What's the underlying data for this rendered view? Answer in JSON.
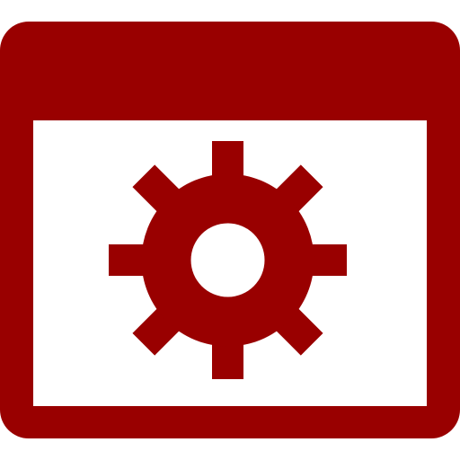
{
  "icon": {
    "name": "app-window-settings-icon",
    "color": "#990000",
    "background": "#ffffff",
    "parts": [
      "window-frame",
      "gear"
    ]
  }
}
